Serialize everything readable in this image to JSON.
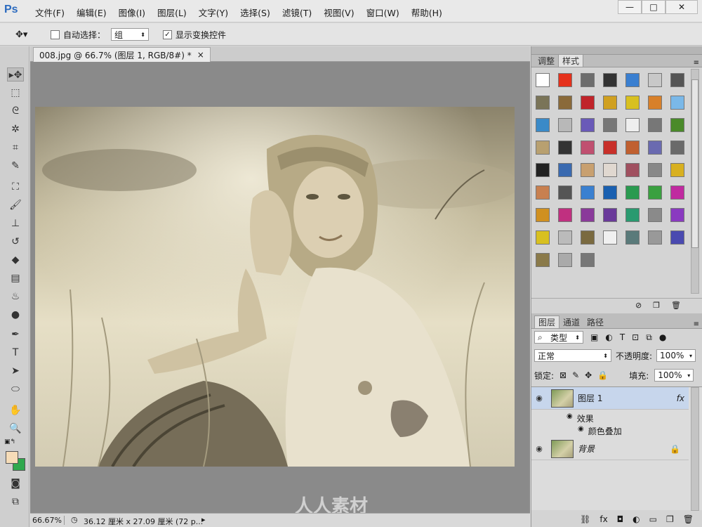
{
  "app": {
    "logo": "Ps"
  },
  "menu": [
    "文件(F)",
    "编辑(E)",
    "图像(I)",
    "图层(L)",
    "文字(Y)",
    "选择(S)",
    "滤镜(T)",
    "视图(V)",
    "窗口(W)",
    "帮助(H)"
  ],
  "window_buttons": {
    "minimize": "—",
    "maximize": "□",
    "close": "✕"
  },
  "options": {
    "auto_select_label": "自动选择：",
    "auto_select_checked": false,
    "auto_select_value": "组",
    "show_transform_label": "显示变换控件",
    "show_transform_checked": true
  },
  "document_tab": {
    "title": "008.jpg @ 66.7% (图层 1, RGB/8#) *",
    "close": "×"
  },
  "status": {
    "zoom": "66.67%",
    "doc_info": "36.12 厘米 x 27.09 厘米 (72 p..."
  },
  "watermark": "人人素材",
  "styles_panel": {
    "tabs": [
      "调整",
      "样式"
    ],
    "active": "样式"
  },
  "layers_panel": {
    "tabs": [
      "图层",
      "通道",
      "路径"
    ],
    "active": "图层",
    "filter_kind": "类型",
    "blend_mode": "正常",
    "opacity_label": "不透明度:",
    "opacity_value": "100%",
    "lock_label": "锁定:",
    "fill_label": "填充:",
    "fill_value": "100%",
    "layers": [
      {
        "name": "图层 1",
        "fx": "fx",
        "effects_label": "效果",
        "effect": "颜色叠加"
      },
      {
        "name": "背景"
      }
    ]
  },
  "colors": {
    "foreground": "#f6dcb8",
    "background": "#2fa84d",
    "accent": "#2c6bbf"
  }
}
